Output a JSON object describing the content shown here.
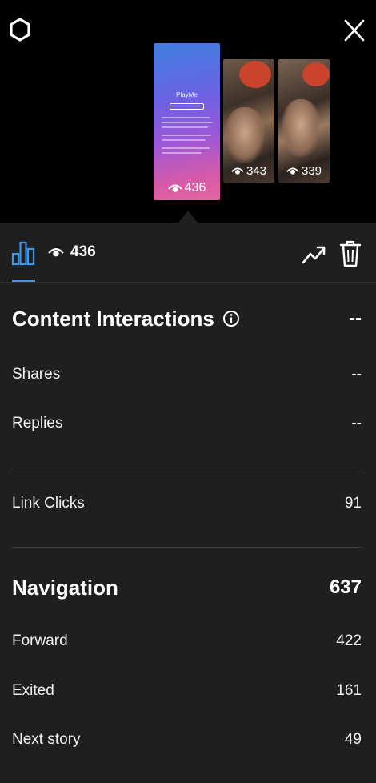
{
  "stories": [
    {
      "views": "436"
    },
    {
      "views": "343"
    },
    {
      "views": "339"
    }
  ],
  "toolbar": {
    "views": "436"
  },
  "content_interactions": {
    "title": "Content Interactions",
    "total": "--",
    "rows": [
      {
        "label": "Shares",
        "value": "--"
      },
      {
        "label": "Replies",
        "value": "--"
      }
    ]
  },
  "link_clicks": {
    "label": "Link Clicks",
    "value": "91"
  },
  "navigation": {
    "title": "Navigation",
    "total": "637",
    "rows": [
      {
        "label": "Forward",
        "value": "422"
      },
      {
        "label": "Exited",
        "value": "161"
      },
      {
        "label": "Next story",
        "value": "49"
      }
    ]
  },
  "thumbnail_text": {
    "brand": "PlayMe"
  },
  "colors": {
    "panel_bg": "#1f1f20",
    "accent": "#3897f0"
  }
}
